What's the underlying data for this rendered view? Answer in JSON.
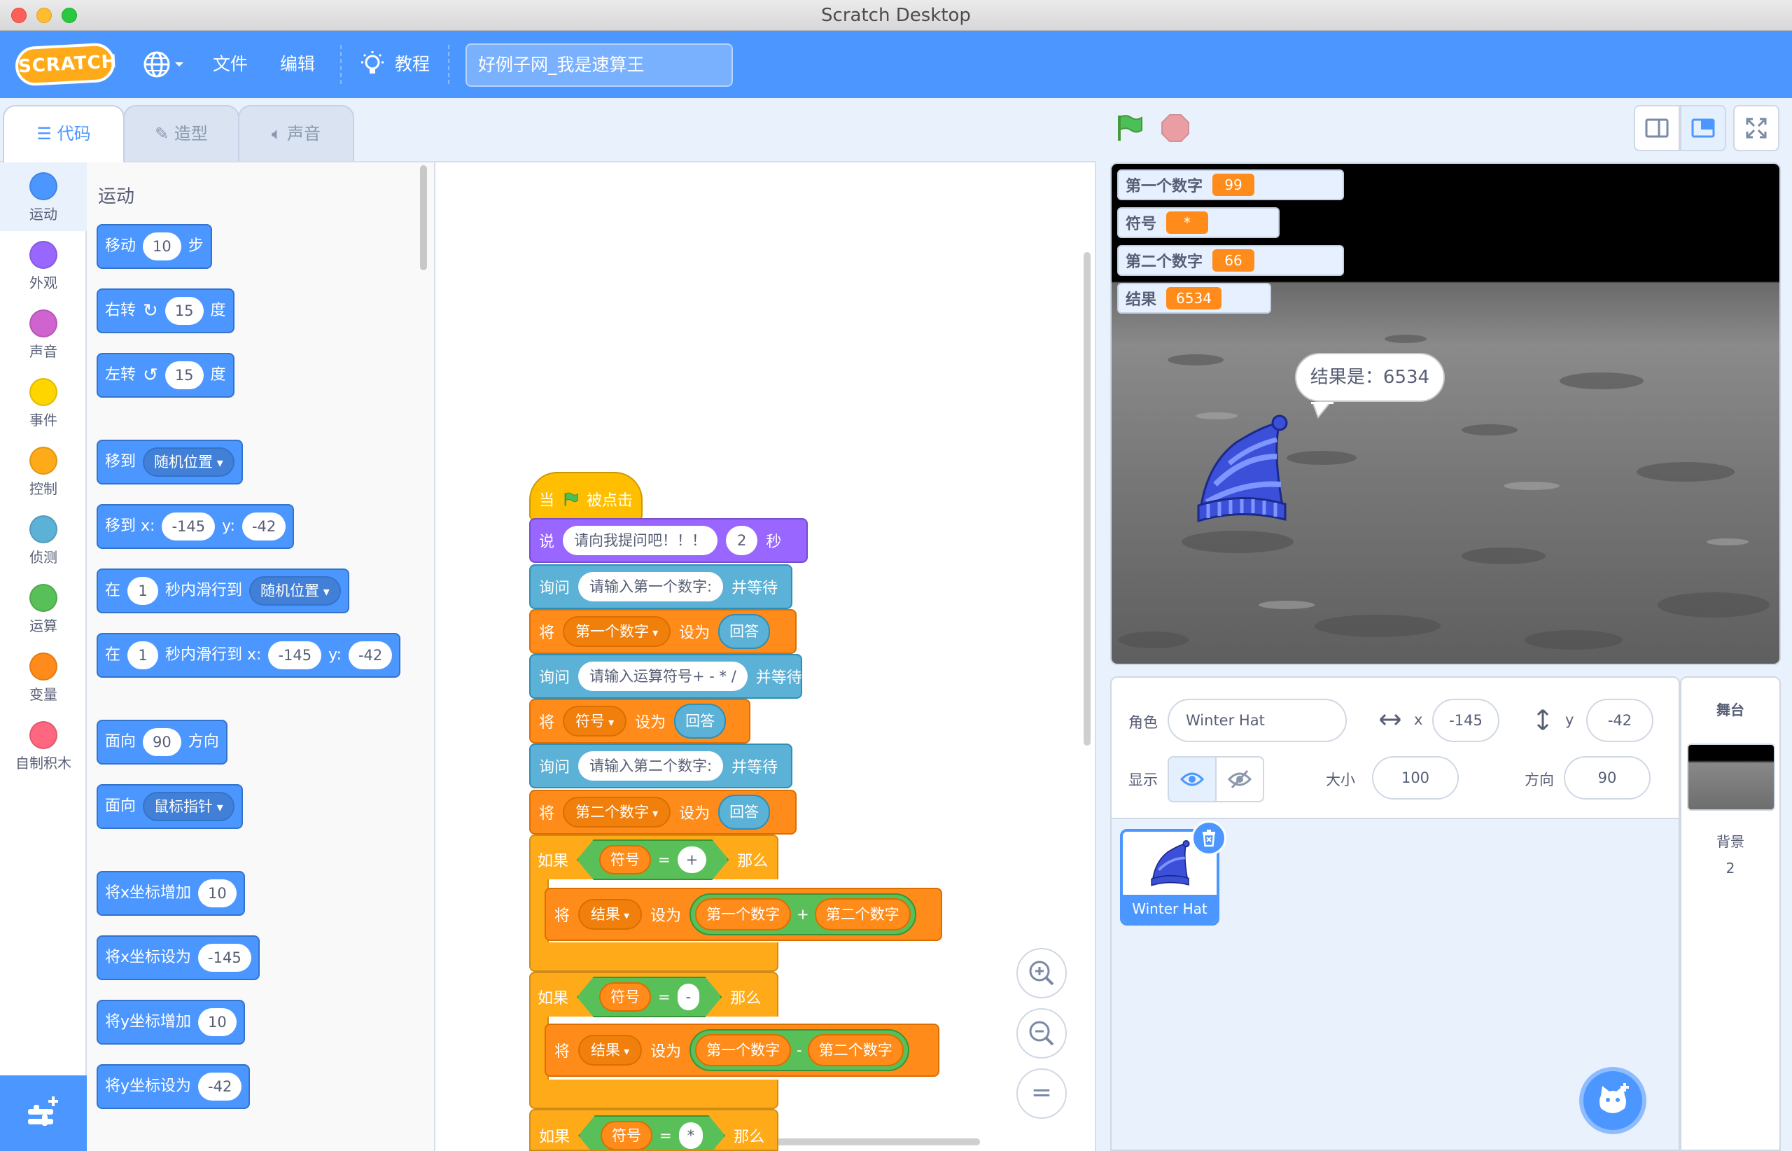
{
  "window": {
    "title": "Scratch Desktop"
  },
  "menu": {
    "logo": "SCRATCH",
    "file": "文件",
    "edit": "编辑",
    "tutorials": "教程",
    "project_title": "好例子网_我是速算王"
  },
  "tabs": {
    "code": "代码",
    "costumes": "造型",
    "sounds": "声音"
  },
  "categories": [
    {
      "label": "运动",
      "color": "#4c97ff"
    },
    {
      "label": "外观",
      "color": "#9966ff"
    },
    {
      "label": "声音",
      "color": "#cf63cf"
    },
    {
      "label": "事件",
      "color": "#ffd500"
    },
    {
      "label": "控制",
      "color": "#ffab19"
    },
    {
      "label": "侦测",
      "color": "#5cb1d6"
    },
    {
      "label": "运算",
      "color": "#59c059"
    },
    {
      "label": "变量",
      "color": "#ff8c1a"
    },
    {
      "label": "自制积木",
      "color": "#ff6680"
    }
  ],
  "palette": {
    "section_title": "运动",
    "move": {
      "a": "移动",
      "v": "10",
      "b": "步"
    },
    "turn_right": {
      "a": "右转",
      "v": "15",
      "b": "度"
    },
    "turn_left": {
      "a": "左转",
      "v": "15",
      "b": "度"
    },
    "goto": {
      "a": "移到",
      "d": "随机位置"
    },
    "goto_xy": {
      "a": "移到 x:",
      "x": "-145",
      "b": "y:",
      "y": "-42"
    },
    "glide": {
      "a": "在",
      "v": "1",
      "b": "秒内滑行到",
      "d": "随机位置"
    },
    "glide_xy": {
      "a": "在",
      "v": "1",
      "b": "秒内滑行到 x:",
      "x": "-145",
      "c": "y:",
      "y": "-42"
    },
    "point_dir": {
      "a": "面向",
      "v": "90",
      "b": "方向"
    },
    "point_towards": {
      "a": "面向",
      "d": "鼠标指针"
    },
    "change_x": {
      "a": "将x坐标增加",
      "v": "10"
    },
    "set_x": {
      "a": "将x坐标设为",
      "v": "-145"
    },
    "change_y": {
      "a": "将y坐标增加",
      "v": "10"
    },
    "set_y": {
      "a": "将y坐标设为",
      "v": "-42"
    }
  },
  "script": {
    "hat": {
      "a": "当",
      "b": "被点击"
    },
    "say": {
      "a": "说",
      "msg": "请向我提问吧！！！",
      "secs": "2",
      "b": "秒"
    },
    "ask1": {
      "a": "询问",
      "q": "请输入第一个数字:",
      "b": "并等待"
    },
    "set1": {
      "a": "将",
      "var": "第一个数字",
      "b": "设为",
      "val": "回答"
    },
    "ask2": {
      "a": "询问",
      "q": "请输入运算符号+ - * /",
      "b": "并等待"
    },
    "set2": {
      "a": "将",
      "var": "符号",
      "b": "设为",
      "val": "回答"
    },
    "ask3": {
      "a": "询问",
      "q": "请输入第二个数字:",
      "b": "并等待"
    },
    "set3": {
      "a": "将",
      "var": "第二个数字",
      "b": "设为",
      "val": "回答"
    },
    "if1": {
      "a": "如果",
      "var": "符号",
      "eq": "=",
      "op": "+",
      "b": "那么"
    },
    "set_res1": {
      "a": "将",
      "var": "结果",
      "b": "设为",
      "l": "第一个数字",
      "op": "+",
      "r": "第二个数字"
    },
    "if2": {
      "a": "如果",
      "var": "符号",
      "eq": "=",
      "op": "-",
      "b": "那么"
    },
    "set_res2": {
      "a": "将",
      "var": "结果",
      "b": "设为",
      "l": "第一个数字",
      "op": "-",
      "r": "第二个数字"
    },
    "if3": {
      "a": "如果",
      "var": "符号",
      "eq": "=",
      "op": "*",
      "b": "那么"
    }
  },
  "zoom": {
    "in": "+",
    "out": "−",
    "reset": "="
  },
  "stage": {
    "monitors": [
      {
        "name": "第一个数字",
        "value": "99"
      },
      {
        "name": "符号",
        "value": "*"
      },
      {
        "name": "第二个数字",
        "value": "66"
      },
      {
        "name": "结果",
        "value": "6534"
      }
    ],
    "bubble": "结果是：6534"
  },
  "sprite_info": {
    "sprite_label": "角色",
    "sprite_name": "Winter Hat",
    "x_label": "x",
    "x": "-145",
    "y_label": "y",
    "y": "-42",
    "show_label": "显示",
    "size_label": "大小",
    "size": "100",
    "direction_label": "方向",
    "direction": "90"
  },
  "sprites": [
    {
      "name": "Winter Hat"
    }
  ],
  "stage_pane": {
    "title": "舞台",
    "backdrop_label": "背景",
    "backdrop_count": "2"
  }
}
